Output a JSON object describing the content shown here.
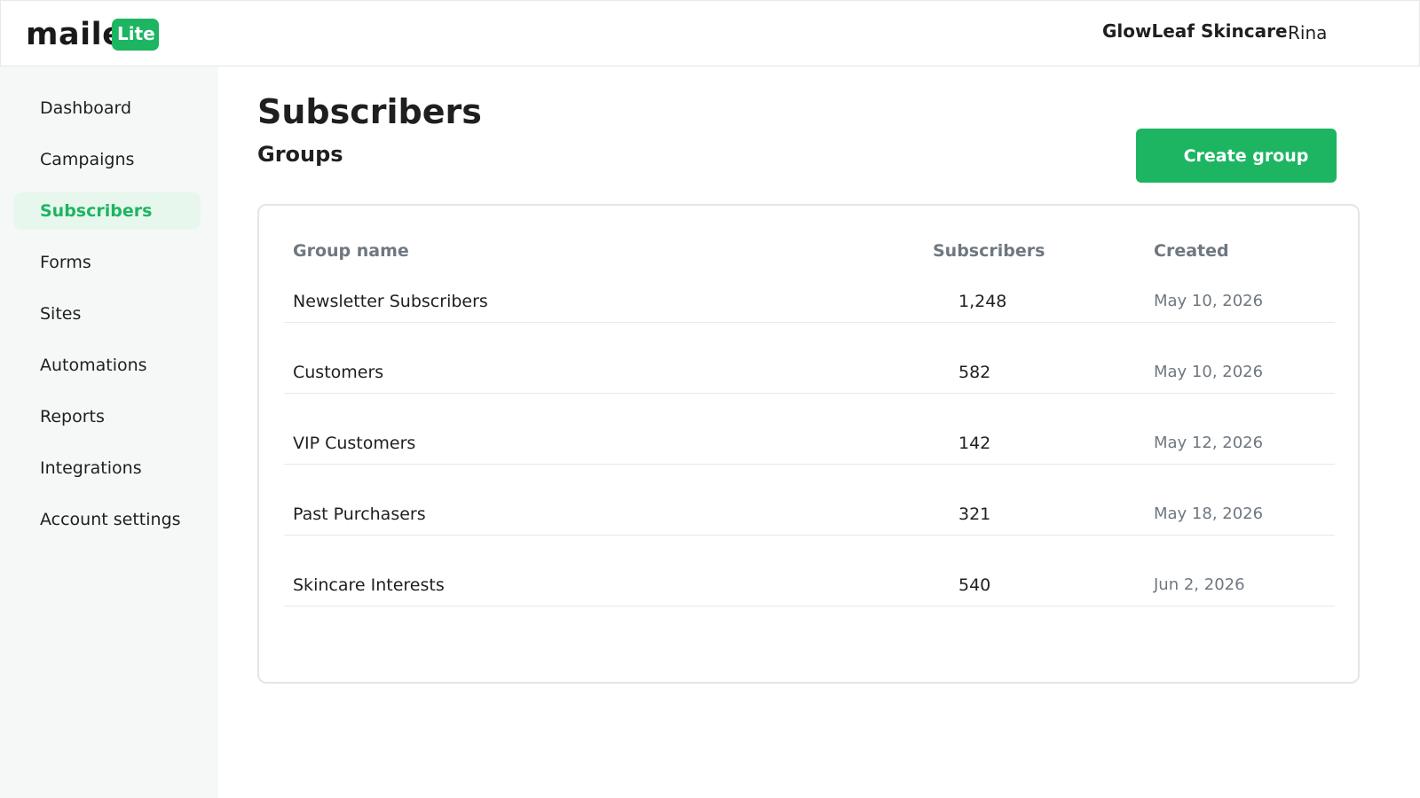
{
  "header": {
    "logo_text": "maile",
    "logo_badge": "Lite",
    "company": "GlowLeaf Skincare",
    "user": "Rina"
  },
  "sidebar": {
    "items": [
      {
        "label": "Dashboard",
        "active": false
      },
      {
        "label": "Campaigns",
        "active": false
      },
      {
        "label": "Subscribers",
        "active": true
      },
      {
        "label": "Forms",
        "active": false
      },
      {
        "label": "Sites",
        "active": false
      },
      {
        "label": "Automations",
        "active": false
      },
      {
        "label": "Reports",
        "active": false
      },
      {
        "label": "Integrations",
        "active": false
      },
      {
        "label": "Account settings",
        "active": false
      }
    ]
  },
  "main": {
    "title": "Subscribers",
    "subtitle": "Groups",
    "create_button": "Create group",
    "table": {
      "columns": [
        "Group name",
        "Subscribers",
        "Created"
      ],
      "rows": [
        {
          "name": "Newsletter Subscribers",
          "subscribers": "1,248",
          "created": "May 10, 2026"
        },
        {
          "name": "Customers",
          "subscribers": "582",
          "created": "May 10, 2026"
        },
        {
          "name": "VIP Customers",
          "subscribers": "142",
          "created": "May 12, 2026"
        },
        {
          "name": "Past Purchasers",
          "subscribers": "321",
          "created": "May 18, 2026"
        },
        {
          "name": "Skincare Interests",
          "subscribers": "540",
          "created": "Jun 2, 2026"
        }
      ]
    }
  },
  "colors": {
    "accent": "#1db562",
    "active_bg": "#e8f7ee",
    "sidebar_bg": "#f6f8f7",
    "muted_text": "#6f7780"
  }
}
